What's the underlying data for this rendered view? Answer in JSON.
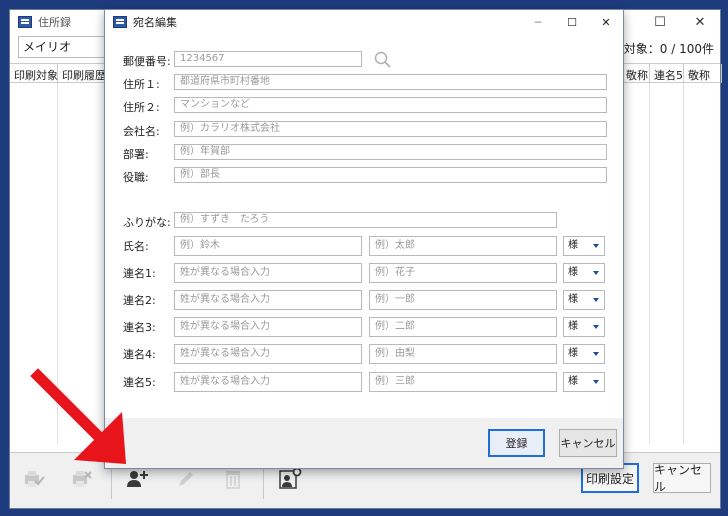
{
  "background_window": {
    "title": "住所録",
    "font_select": "メイリオ",
    "count_label": "印刷対象：",
    "count_value": "0 / 100件",
    "left_columns": [
      "印刷対象",
      "印刷履歴"
    ],
    "right_columns": [
      "敬称",
      "連名5",
      "敬称"
    ],
    "print_settings_label": "印刷設定",
    "cancel_label": "キャンセル"
  },
  "dialog": {
    "title": "宛名編集",
    "fields": {
      "postal": {
        "label": "郵便番号:",
        "placeholder": "1234567"
      },
      "address1": {
        "label": "住所１:",
        "placeholder": "都道府県市町村番地"
      },
      "address2": {
        "label": "住所２:",
        "placeholder": "マンションなど"
      },
      "company": {
        "label": "会社名:",
        "placeholder": "例）カラリオ株式会社"
      },
      "department": {
        "label": "部署:",
        "placeholder": "例）年賀部"
      },
      "position": {
        "label": "役職:",
        "placeholder": "例）部長"
      },
      "furigana": {
        "label": "ふりがな:",
        "placeholder": "例）すずき　たろう"
      }
    },
    "name_rows": [
      {
        "label": "氏名:",
        "last_placeholder": "例）鈴木",
        "first_placeholder": "例）太郎",
        "honorific": "様"
      },
      {
        "label": "連名1:",
        "last_placeholder": "姓が異なる場合入力",
        "first_placeholder": "例）花子",
        "honorific": "様"
      },
      {
        "label": "連名2:",
        "last_placeholder": "姓が異なる場合入力",
        "first_placeholder": "例）一郎",
        "honorific": "様"
      },
      {
        "label": "連名3:",
        "last_placeholder": "姓が異なる場合入力",
        "first_placeholder": "例）二郎",
        "honorific": "様"
      },
      {
        "label": "連名4:",
        "last_placeholder": "姓が異なる場合入力",
        "first_placeholder": "例）由梨",
        "honorific": "様"
      },
      {
        "label": "連名5:",
        "last_placeholder": "姓が異なる場合入力",
        "first_placeholder": "例）三郎",
        "honorific": "様"
      }
    ],
    "register_label": "登録",
    "cancel_label": "キャンセル"
  },
  "icons": {
    "search": "search-icon",
    "add_person": "add-person-icon",
    "pencil": "pencil-icon",
    "trash": "trash-icon",
    "settings_person": "person-settings-icon",
    "arrow_color": "#e8141b",
    "accent_color": "#1e6fd9"
  }
}
